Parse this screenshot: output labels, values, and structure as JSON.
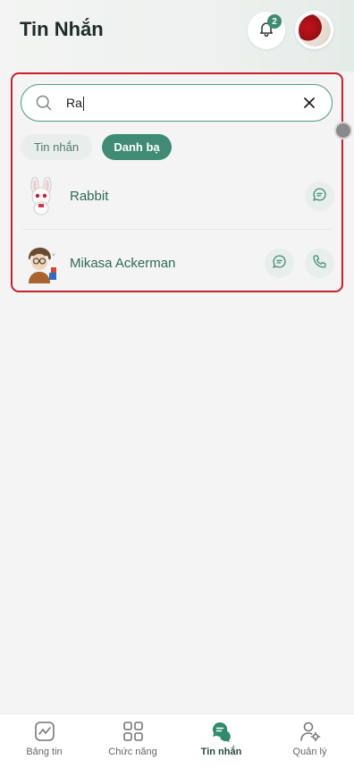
{
  "header": {
    "title": "Tin Nhắn",
    "notification_count": "2"
  },
  "search": {
    "value": "Ra"
  },
  "tabs": [
    {
      "label": "Tin nhắn",
      "active": false
    },
    {
      "label": "Danh bạ",
      "active": true
    }
  ],
  "contacts": [
    {
      "name": "Rabbit",
      "actions": [
        "message-icon"
      ]
    },
    {
      "name": "Mikasa Ackerman",
      "actions": [
        "message-icon",
        "phone-icon"
      ]
    }
  ],
  "bottom_nav": [
    {
      "label": "Bảng tin",
      "icon": "newsfeed-icon"
    },
    {
      "label": "Chức năng",
      "icon": "grid-icon"
    },
    {
      "label": "Tin nhắn",
      "icon": "chat-icon",
      "active": true
    },
    {
      "label": "Quản lý",
      "icon": "user-settings-icon"
    }
  ],
  "colors": {
    "accent": "#3f8b74",
    "highlight_border": "#c8202a"
  }
}
